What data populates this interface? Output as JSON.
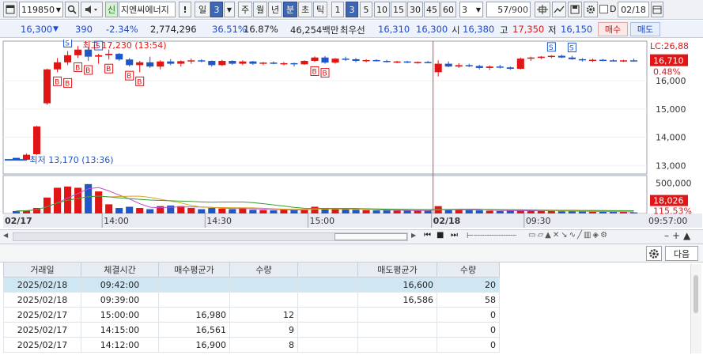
{
  "toolbar": {
    "code": "119850",
    "name": "지엔씨에너지",
    "exclaim": "!",
    "periods": [
      "일",
      "3",
      "주",
      "월",
      "년",
      "분",
      "초",
      "틱"
    ],
    "selected_period": "분",
    "intervals": [
      "1",
      "3",
      "5",
      "10",
      "15",
      "30",
      "45",
      "60"
    ],
    "selected_interval": "3",
    "unit_value": "3",
    "count_display": "57",
    "count_max": "/900",
    "date_checkbox_label": "D",
    "date_value": "02/18",
    "green_label": "신"
  },
  "quote": {
    "price": "16,300",
    "change": "390",
    "change_pct": "-2.34%",
    "volume": "2,774,296",
    "vol_ratio": "36.51%",
    "turnover": "16.87%",
    "amount": "46,254백만",
    "best_label": "최우선",
    "best_ask": "16,310",
    "best_bid": "16,300",
    "open_label": "시",
    "open": "16,380",
    "high_label": "고",
    "high": "17,350",
    "low_label": "저",
    "low": "16,150",
    "buy_label": "매수",
    "sell_label": "매도"
  },
  "chart_data": {
    "type": "candlestick",
    "price_axis_ticks": [
      "16,000",
      "15,000",
      "14,000",
      "13,000"
    ],
    "price_range": [
      12700,
      17400
    ],
    "volume_axis_ticks": [
      "500,000"
    ],
    "volume_range": [
      0,
      620000
    ],
    "lc_label": "LC:26,88",
    "last_price_tag": "16,710",
    "last_pct_tag": "0.48%",
    "volume_tag": "18,026",
    "volume_pct_tag": "115.53%",
    "high_annotation": "최고 17,230 (13:54)",
    "low_annotation": "최저 13,170 (13:36)",
    "time_labels": [
      "02/17",
      "14:00",
      "14:30",
      "15:00",
      "02/18",
      "09:30",
      "09:57:00"
    ],
    "candles": [
      [
        13270,
        13270,
        13200,
        13200
      ],
      [
        13200,
        13420,
        13170,
        13380
      ],
      [
        13400,
        14400,
        13380,
        14380
      ],
      [
        15200,
        16420,
        15150,
        16400
      ],
      [
        16400,
        16800,
        16300,
        16650
      ],
      [
        16650,
        17050,
        16550,
        16900
      ],
      [
        16900,
        17230,
        16800,
        17100
      ],
      [
        17100,
        17180,
        16700,
        16850
      ],
      [
        16850,
        16950,
        16600,
        16900
      ],
      [
        16900,
        17100,
        16750,
        16950
      ],
      [
        16950,
        16980,
        16700,
        16750
      ],
      [
        16750,
        16800,
        16500,
        16550
      ],
      [
        16550,
        16700,
        16300,
        16650
      ],
      [
        16650,
        16850,
        16450,
        16500
      ],
      [
        16500,
        16720,
        16400,
        16680
      ],
      [
        16680,
        16760,
        16550,
        16600
      ],
      [
        16600,
        16720,
        16500,
        16690
      ],
      [
        16690,
        16780,
        16600,
        16720
      ],
      [
        16720,
        16760,
        16650,
        16700
      ],
      [
        16700,
        16720,
        16500,
        16550
      ],
      [
        16550,
        16740,
        16520,
        16700
      ],
      [
        16700,
        16720,
        16560,
        16600
      ],
      [
        16600,
        16720,
        16550,
        16680
      ],
      [
        16680,
        16700,
        16560,
        16600
      ],
      [
        16600,
        16660,
        16550,
        16640
      ],
      [
        16640,
        16680,
        16580,
        16600
      ],
      [
        16600,
        16660,
        16540,
        16620
      ],
      [
        16620,
        16640,
        16500,
        16580
      ],
      [
        16580,
        16720,
        16560,
        16700
      ],
      [
        16700,
        16860,
        16660,
        16820
      ],
      [
        16820,
        16870,
        16600,
        16640
      ],
      [
        16640,
        16800,
        16600,
        16780
      ],
      [
        16780,
        16850,
        16700,
        16760
      ],
      [
        16760,
        16800,
        16650,
        16700
      ],
      [
        16700,
        16760,
        16650,
        16730
      ],
      [
        16730,
        16760,
        16680,
        16700
      ],
      [
        16700,
        16740,
        16640,
        16660
      ],
      [
        16660,
        16700,
        16620,
        16680
      ],
      [
        16680,
        16700,
        16620,
        16650
      ],
      [
        16650,
        16680,
        16600,
        16660
      ],
      [
        16660,
        16700,
        16630,
        16650
      ],
      [
        16300,
        16720,
        16150,
        16600
      ],
      [
        16600,
        16680,
        16480,
        16500
      ],
      [
        16500,
        16620,
        16450,
        16550
      ],
      [
        16550,
        16600,
        16480,
        16520
      ],
      [
        16520,
        16560,
        16400,
        16450
      ],
      [
        16450,
        16540,
        16380,
        16500
      ],
      [
        16500,
        16560,
        16430,
        16470
      ],
      [
        16470,
        16500,
        16380,
        16420
      ],
      [
        16420,
        16820,
        16400,
        16780
      ],
      [
        16780,
        16850,
        16700,
        16820
      ],
      [
        16820,
        16870,
        16760,
        16850
      ],
      [
        16850,
        16900,
        16800,
        16880
      ],
      [
        16880,
        16920,
        16800,
        16820
      ],
      [
        16820,
        16880,
        16740,
        16760
      ],
      [
        16760,
        16800,
        16680,
        16720
      ],
      [
        16720,
        16780,
        16660,
        16740
      ],
      [
        16740,
        16770,
        16690,
        16720
      ],
      [
        16720,
        16760,
        16680,
        16700
      ],
      [
        16700,
        16740,
        16660,
        16720
      ],
      [
        16720,
        16780,
        16680,
        16710
      ]
    ],
    "volumes": [
      40000,
      52000,
      90000,
      260000,
      420000,
      440000,
      420000,
      480000,
      360000,
      150000,
      90000,
      110000,
      90000,
      70000,
      120000,
      130000,
      120000,
      90000,
      70000,
      90000,
      80000,
      70000,
      90000,
      60000,
      55000,
      50000,
      60000,
      55000,
      70000,
      110000,
      90000,
      80000,
      70000,
      60000,
      55000,
      50000,
      50000,
      45000,
      50000,
      45000,
      50000,
      120000,
      70000,
      60000,
      55000,
      50000,
      45000,
      40000,
      45000,
      55000,
      45000,
      40000,
      38000,
      36000,
      34000,
      32000,
      30000,
      28000,
      27000,
      26000,
      18026
    ],
    "markers": [
      {
        "index": 4,
        "type": "B"
      },
      {
        "index": 5,
        "type": "S"
      },
      {
        "index": 5,
        "type": "B"
      },
      {
        "index": 6,
        "type": "B"
      },
      {
        "index": 7,
        "type": "B"
      },
      {
        "index": 7,
        "type": "S"
      },
      {
        "index": 8,
        "type": "S"
      },
      {
        "index": 9,
        "type": "B"
      },
      {
        "index": 11,
        "type": "B"
      },
      {
        "index": 12,
        "type": "B"
      },
      {
        "index": 29,
        "type": "B"
      },
      {
        "index": 30,
        "type": "B"
      },
      {
        "index": 52,
        "type": "S"
      },
      {
        "index": 54,
        "type": "S"
      }
    ]
  },
  "table": {
    "headers": [
      "거래일",
      "체결시간",
      "매수평균가",
      "수량",
      "",
      "매도평균가",
      "수량"
    ],
    "rows": [
      [
        "2025/02/18",
        "09:42:00",
        "",
        "",
        "",
        "16,600",
        "20"
      ],
      [
        "2025/02/18",
        "09:39:00",
        "",
        "",
        "",
        "16,586",
        "58"
      ],
      [
        "2025/02/17",
        "15:00:00",
        "16,980",
        "12",
        "",
        "",
        "0"
      ],
      [
        "2025/02/17",
        "14:15:00",
        "16,561",
        "9",
        "",
        "",
        "0"
      ],
      [
        "2025/02/17",
        "14:12:00",
        "16,900",
        "8",
        "",
        "",
        "0"
      ]
    ]
  },
  "section": {
    "next_label": "다음"
  },
  "colors": {
    "up": "#e01515",
    "down": "#1f56c8",
    "accent": "#3f66b0"
  }
}
